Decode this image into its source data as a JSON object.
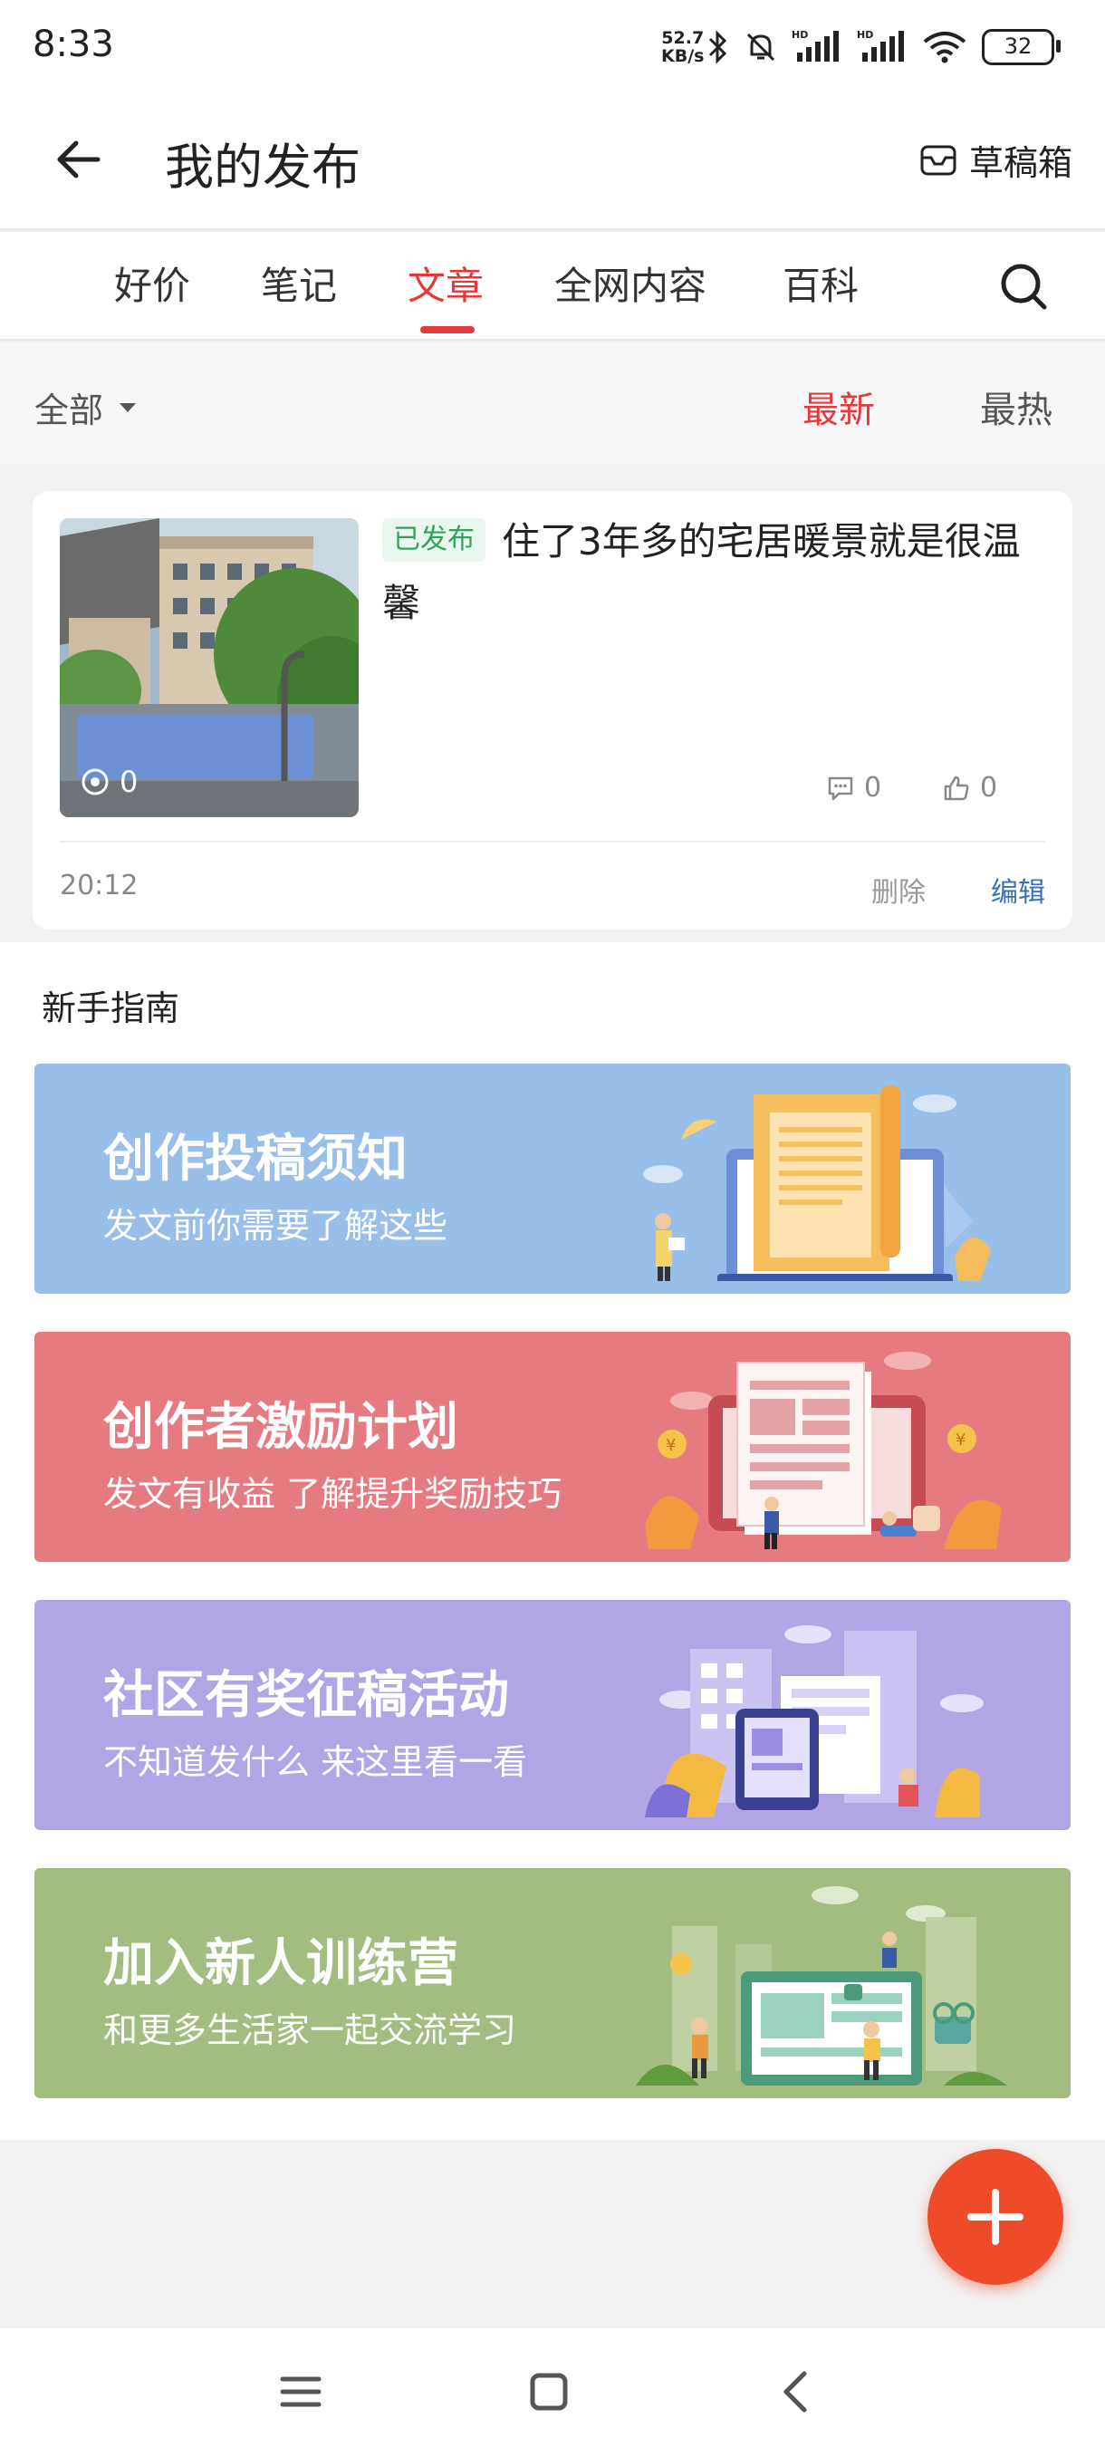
{
  "status_bar": {
    "time": "8:33",
    "net_speed_value": "52.7",
    "net_speed_unit": "KB/s",
    "battery": "32",
    "icons": [
      "bluetooth-icon",
      "mute-bell-icon",
      "hd-signal-icon",
      "hd-signal-icon",
      "wifi-icon",
      "battery-icon"
    ]
  },
  "header": {
    "title": "我的发布",
    "draft_label": "草稿箱",
    "back_icon": "arrow-left-icon",
    "draft_icon": "inbox-icon"
  },
  "tabs": [
    {
      "label": "好价",
      "active": false
    },
    {
      "label": "笔记",
      "active": false
    },
    {
      "label": "文章",
      "active": true
    },
    {
      "label": "全网内容",
      "active": false
    },
    {
      "label": "百科",
      "active": false
    }
  ],
  "filter": {
    "category": "全部",
    "sort_newest": "最新",
    "sort_hottest": "最热",
    "active_sort": "最新"
  },
  "article": {
    "status": "已发布",
    "title": "住了3年多的宅居暖景就是很温馨",
    "views": "0",
    "comments": "0",
    "likes": "0",
    "time": "20:12",
    "delete_label": "删除",
    "edit_label": "编辑"
  },
  "guide": {
    "heading": "新手指南",
    "banners": [
      {
        "title": "创作投稿须知",
        "subtitle": "发文前你需要了解这些",
        "color": "#97bfe9"
      },
      {
        "title": "创作者激励计划",
        "subtitle": "发文有收益 了解提升奖励技巧",
        "color": "#e57b80"
      },
      {
        "title": "社区有奖征稿活动",
        "subtitle": "不知道发什么 来这里看一看",
        "color": "#b1a5e6"
      },
      {
        "title": "加入新人训练营",
        "subtitle": "和更多生活家一起交流学习",
        "color": "#a3bd80"
      }
    ]
  },
  "colors": {
    "accent": "#e4393c",
    "published_green": "#31a35a",
    "fab": "#ef4a2a"
  }
}
